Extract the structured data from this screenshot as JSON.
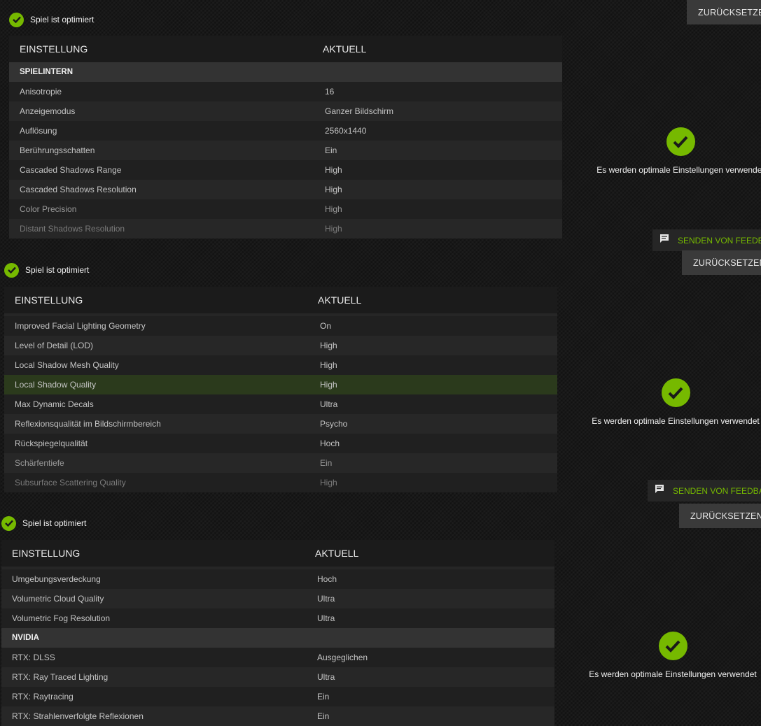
{
  "panels": [
    {
      "status": "Spiel ist optimiert",
      "reset": "ZURÜCKSETZEN",
      "columns": {
        "setting": "EINSTELLUNG",
        "current": "AKTUELL"
      },
      "section": "SPIELINTERN",
      "rows": [
        {
          "name": "Anisotropie",
          "value": "16"
        },
        {
          "name": "Anzeigemodus",
          "value": "Ganzer Bildschirm"
        },
        {
          "name": "Auflösung",
          "value": "2560x1440"
        },
        {
          "name": "Berührungsschatten",
          "value": "Ein"
        },
        {
          "name": "Cascaded Shadows Range",
          "value": "High"
        },
        {
          "name": "Cascaded Shadows Resolution",
          "value": "High"
        },
        {
          "name": "Color Precision",
          "value": "High"
        },
        {
          "name": "Distant Shadows Resolution",
          "value": "High"
        }
      ],
      "optimal": "Es werden optimale Einstellungen verwendet",
      "feedback": "SENDEN VON FEEDBACK"
    },
    {
      "status": "Spiel ist optimiert",
      "reset": "ZURÜCKSETZEN",
      "columns": {
        "setting": "EINSTELLUNG",
        "current": "AKTUELL"
      },
      "rows": [
        {
          "name": "Improved Facial Lighting Geometry",
          "value": "On"
        },
        {
          "name": "Level of Detail (LOD)",
          "value": "High"
        },
        {
          "name": "Local Shadow Mesh Quality",
          "value": "High"
        },
        {
          "name": "Local Shadow Quality",
          "value": "High"
        },
        {
          "name": "Max Dynamic Decals",
          "value": "Ultra"
        },
        {
          "name": "Reflexionsqualität im Bildschirmbereich",
          "value": "Psycho"
        },
        {
          "name": "Rückspiegelqualität",
          "value": "Hoch"
        },
        {
          "name": "Schärfentiefe",
          "value": "Ein"
        },
        {
          "name": "Subsurface Scattering Quality",
          "value": "High"
        }
      ],
      "optimal": "Es werden optimale Einstellungen verwendet",
      "feedback": "SENDEN VON FEEDBACK"
    },
    {
      "status": "Spiel ist optimiert",
      "reset": "ZURÜCKSETZEN",
      "columns": {
        "setting": "EINSTELLUNG",
        "current": "AKTUELL"
      },
      "rows_a": [
        {
          "name": "Umgebungsverdeckung",
          "value": "Hoch"
        },
        {
          "name": "Volumetric Cloud Quality",
          "value": "Ultra"
        },
        {
          "name": "Volumetric Fog Resolution",
          "value": "Ultra"
        }
      ],
      "section": "NVIDIA",
      "rows_b": [
        {
          "name": "RTX: DLSS",
          "value": "Ausgeglichen"
        },
        {
          "name": "RTX: Ray Traced Lighting",
          "value": "Ultra"
        },
        {
          "name": "RTX: Raytracing",
          "value": "Ein"
        },
        {
          "name": "RTX: Strahlenverfolgte Reflexionen",
          "value": "Ein"
        }
      ],
      "optimal": "Es werden optimale Einstellungen verwendet"
    }
  ],
  "accent": "#76b900",
  "highlight_row": "Local Shadow Quality"
}
